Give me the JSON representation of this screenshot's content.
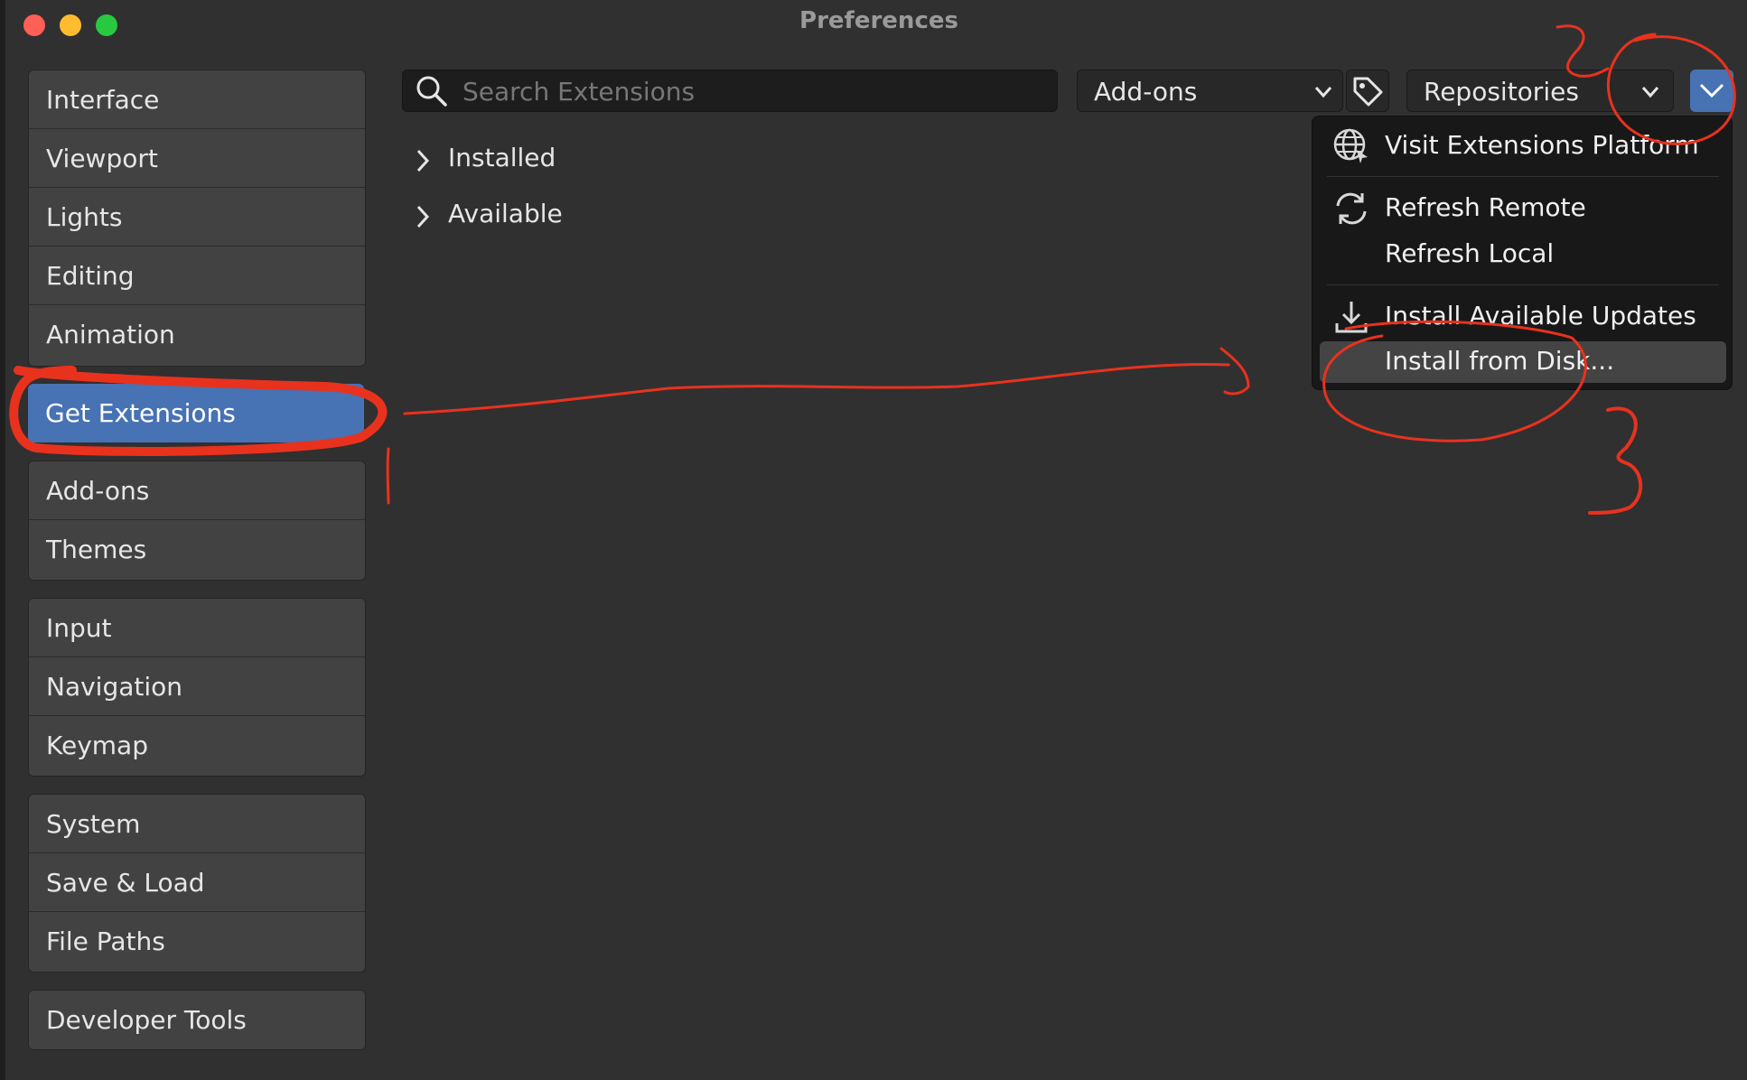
{
  "window": {
    "title": "Preferences"
  },
  "sidebar": {
    "groups": [
      {
        "items": [
          "Interface",
          "Viewport",
          "Lights",
          "Editing",
          "Animation"
        ]
      },
      {
        "items": [
          "Get Extensions"
        ]
      },
      {
        "items": [
          "Add-ons",
          "Themes"
        ]
      },
      {
        "items": [
          "Input",
          "Navigation",
          "Keymap"
        ]
      },
      {
        "items": [
          "System",
          "Save & Load",
          "File Paths"
        ]
      },
      {
        "items": [
          "Developer Tools"
        ]
      }
    ],
    "active": "Get Extensions"
  },
  "toolbar": {
    "search_placeholder": "Search Extensions",
    "type_filter": "Add-ons",
    "repositories": "Repositories"
  },
  "tree": {
    "items": [
      "Installed",
      "Available"
    ]
  },
  "menu": {
    "items": [
      {
        "label": "Visit Extensions Platform",
        "icon": "globe-icon"
      },
      {
        "label": "Refresh Remote",
        "icon": "refresh-icon"
      },
      {
        "label": "Refresh Local",
        "icon": ""
      },
      {
        "label": "Install Available Updates",
        "icon": "download-icon"
      },
      {
        "label": "Install from Disk...",
        "icon": ""
      }
    ],
    "highlighted": "Install from Disk..."
  },
  "colors": {
    "background": "#303030",
    "accent": "#4772b3",
    "annotation": "#e8321e",
    "menu_bg": "#181818"
  },
  "annotations": {
    "labels": [
      "1",
      "2",
      "3"
    ]
  }
}
